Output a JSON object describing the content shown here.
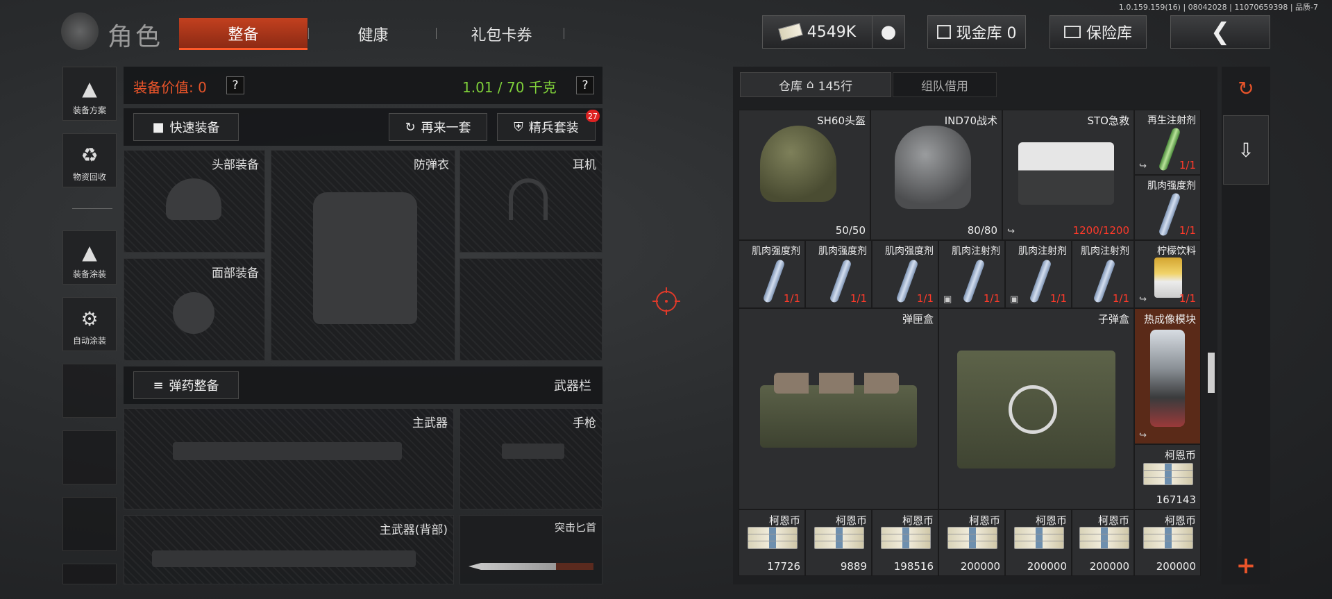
{
  "build_info": "1.0.159.159(16) | 08042028 | 11070659398 | 品质-7",
  "header": {
    "title": "角色",
    "tabs": [
      {
        "label": "整备",
        "active": true
      },
      {
        "label": "健康",
        "active": false
      },
      {
        "label": "礼包卡券",
        "active": false
      }
    ],
    "currency": "4549K",
    "cash_vault": "现金库 0",
    "safe": "保险库"
  },
  "sidebar": {
    "items": [
      {
        "label": "装备方案",
        "icon": "helmet-icon"
      },
      {
        "label": "物资回收",
        "icon": "recycle-icon"
      },
      {
        "label": "装备涂装",
        "icon": "paint-icon"
      },
      {
        "label": "自动涂装",
        "icon": "auto-paint-icon"
      }
    ]
  },
  "loadout": {
    "value_label": "装备价值: 0",
    "weight": "1.01 / 70 千克",
    "help": "?",
    "quick_equip": "快速装备",
    "again": "再来一套",
    "elite": "精兵套装",
    "elite_badge": "27",
    "ammo_equip": "弹药整备",
    "weapon_bar": "武器栏",
    "slots": {
      "head": "头部装备",
      "face": "面部装备",
      "armor": "防弹衣",
      "headset": "耳机",
      "primary": "主武器",
      "pistol": "手枪",
      "primary_back": "主武器(背部)",
      "knife": "突击匕首"
    }
  },
  "warehouse": {
    "tab_label": "仓库",
    "rows": "145行",
    "tab2": "组队借用",
    "items": [
      {
        "name": "SH60头盔",
        "qty": "50/50"
      },
      {
        "name": "IND70战术",
        "qty": "80/80"
      },
      {
        "name": "STO急救",
        "qty": "1200/1200"
      },
      {
        "name": "再生注射剂",
        "qty": "1/1"
      },
      {
        "name": "肌肉强度剂",
        "qty": "1/1"
      },
      {
        "name": "肌肉强度剂",
        "qty": "1/1"
      },
      {
        "name": "肌肉强度剂",
        "qty": "1/1"
      },
      {
        "name": "肌肉强度剂",
        "qty": "1/1"
      },
      {
        "name": "肌肉注射剂",
        "qty": "1/1"
      },
      {
        "name": "肌肉注射剂",
        "qty": "1/1"
      },
      {
        "name": "肌肉注射剂",
        "qty": "1/1"
      },
      {
        "name": "柠檬饮料",
        "qty": "1/1"
      },
      {
        "name": "弹匣盒",
        "qty": ""
      },
      {
        "name": "子弹盒",
        "qty": ""
      },
      {
        "name": "热成像模块",
        "qty": ""
      },
      {
        "name": "柯恩币",
        "qty": "167143"
      },
      {
        "name": "柯恩币",
        "qty": "17726"
      },
      {
        "name": "柯恩币",
        "qty": "9889"
      },
      {
        "name": "柯恩币",
        "qty": "198516"
      },
      {
        "name": "柯恩币",
        "qty": "200000"
      },
      {
        "name": "柯恩币",
        "qty": "200000"
      },
      {
        "name": "柯恩币",
        "qty": "200000"
      },
      {
        "name": "柯恩币",
        "qty": "200000"
      }
    ],
    "add": "+"
  },
  "colors": {
    "accent": "#e8542a",
    "red_qty": "#ff3a2a",
    "weight_green": "#7fd03a"
  }
}
